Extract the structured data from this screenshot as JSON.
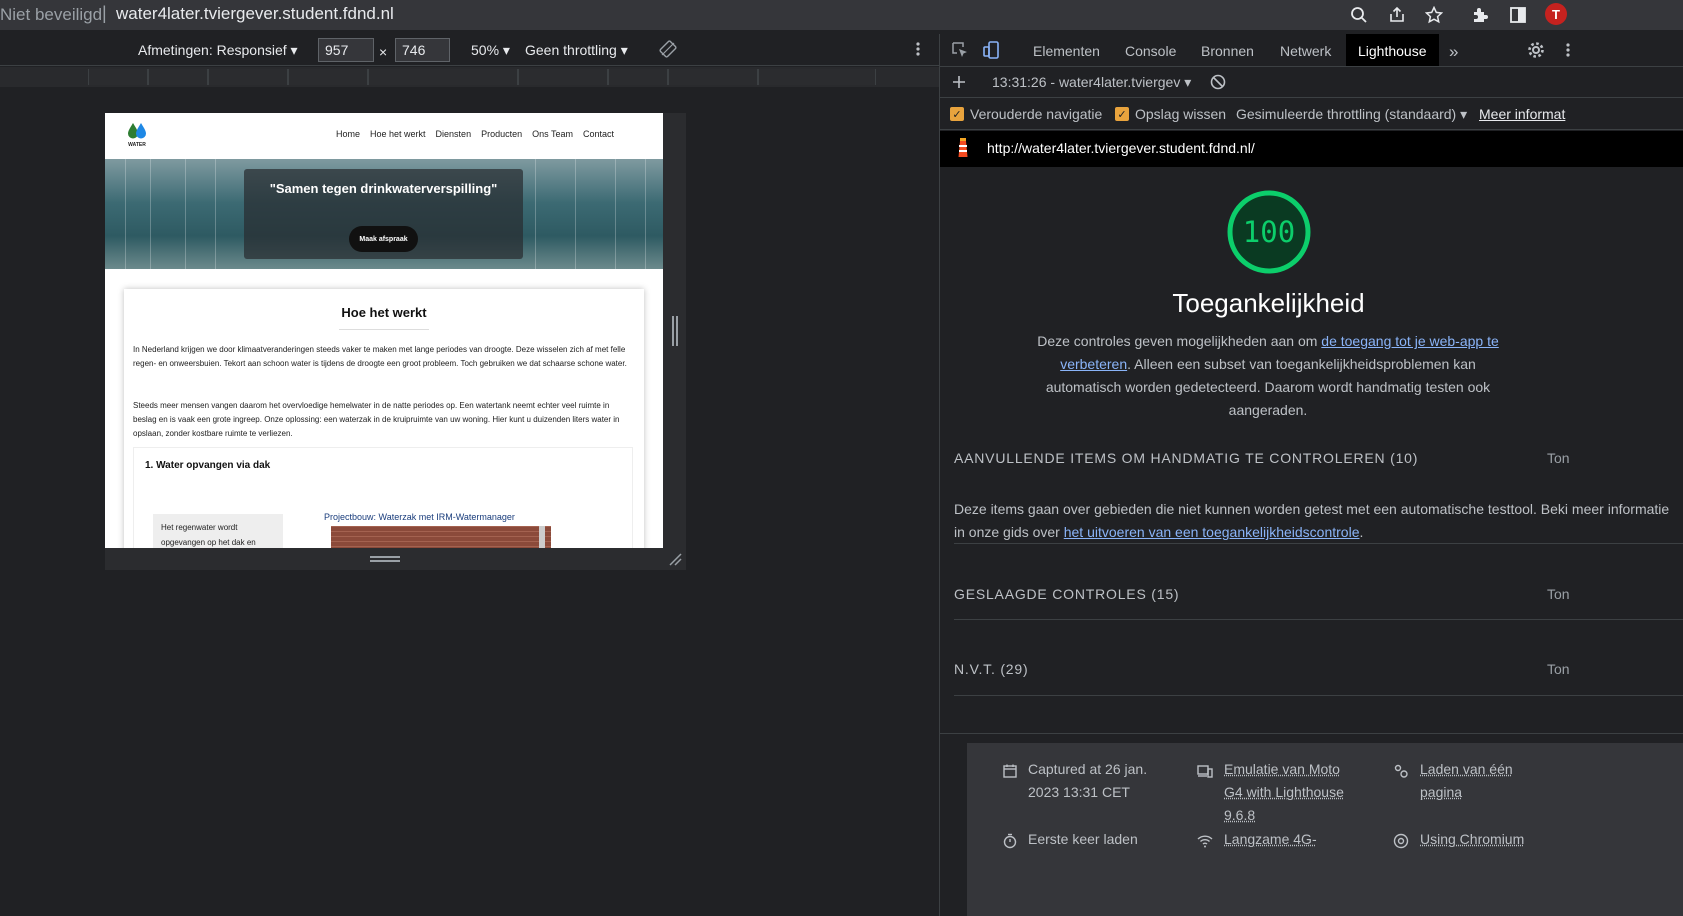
{
  "browser": {
    "security_label": "Niet beveiligd",
    "url_separator": "|",
    "url": "water4later.tviergever.student.fdnd.nl",
    "avatar_initial": "T"
  },
  "device_toolbar": {
    "dimensions_label": "Afmetingen: Responsief",
    "width": "957",
    "times": "×",
    "height": "746",
    "zoom": "50%",
    "throttling": "Geen throttling"
  },
  "site": {
    "logo_text": "WATER",
    "nav": [
      "Home",
      "Hoe het werkt",
      "Diensten",
      "Producten",
      "Ons Team",
      "Contact"
    ],
    "hero_quote": "\"Samen tegen drinkwaterverspilling\"",
    "hero_button": "Maak afspraak",
    "section_title": "Hoe het werkt",
    "paragraph1": "In Nederland krijgen we door klimaatveranderingen steeds vaker te maken met lange periodes van droogte. Deze wisselen zich af met felle regen- en onweersbuien. Tekort aan schoon water is tijdens de droogte een groot probleem. Toch gebruiken we dat schaarse schone water.",
    "paragraph2": "Steeds meer mensen vangen daarom het overvloedige hemelwater in de natte periodes op. Een watertank neemt echter veel ruimte in beslag en is vaak een grote ingreep. Onze oplossing: een waterzak in de kruipruimte van uw woning. Hier kunt u duizenden liters water in opslaan, zonder kostbare ruimte te verliezen.",
    "step_title": "1. Water opvangen via dak",
    "step_note": "Het regenwater wordt opgevangen op het dak en",
    "project_label": "Projectbouw: Waterzak met IRM-Watermanager"
  },
  "devtools": {
    "tabs": [
      "Elementen",
      "Console",
      "Bronnen",
      "Netwerk",
      "Lighthouse"
    ],
    "active_tab": "Lighthouse",
    "more_tabs": "»",
    "report_selector": "13:31:26 - water4later.tvierge​v",
    "legacy_nav_label": "Verouderde navigatie",
    "clear_storage_label": "Opslag wissen",
    "throttling_label": "Gesimuleerde throttling (standaard)",
    "more_info": "Meer informat",
    "report_url": "http://water4later.tviergever.student.fdnd.nl/"
  },
  "lighthouse": {
    "score": "100",
    "score_fraction": 1.0,
    "category": "Toegankelijkheid",
    "desc_before": "Deze controles geven mogelijkheden aan om ",
    "desc_link": "de toegang tot je web-app te verbeteren",
    "desc_after": ". Alleen een subset van toegankelijkheidsproblemen kan automatisch worden gedetecteerd. Daarom wordt handmatig testen ook aangeraden.",
    "groups": [
      {
        "title": "AANVULLENDE ITEMS OM HANDMATIG TE CONTROLEREN (10)",
        "toggle": "Ton"
      },
      {
        "title": "GESLAAGDE CONTROLES (15)",
        "toggle": "Ton"
      },
      {
        "title": "N.V.T. (29)",
        "toggle": "Ton"
      }
    ],
    "manual_before": "Deze items gaan over gebieden die niet kunnen worden getest met een automatische testtool. Beki meer informatie in onze gids over ",
    "manual_link": "het uitvoeren van een toegankelijkheidscontrole",
    "manual_after": ".",
    "footer": {
      "captured": "Captured at 26 jan. 2023 13:31 CET",
      "emulation": "Emulatie van Moto G4 with Lighthouse 9.6.8",
      "page_load": "Laden van één pagina",
      "first_load": "Eerste keer laden",
      "network": "Langzame 4G-",
      "browser": "Using Chromium"
    }
  },
  "colors": {
    "score_green": "#0cce6b",
    "checkbox_orange": "#e8a33d",
    "link_blue": "#8ab4f8"
  }
}
